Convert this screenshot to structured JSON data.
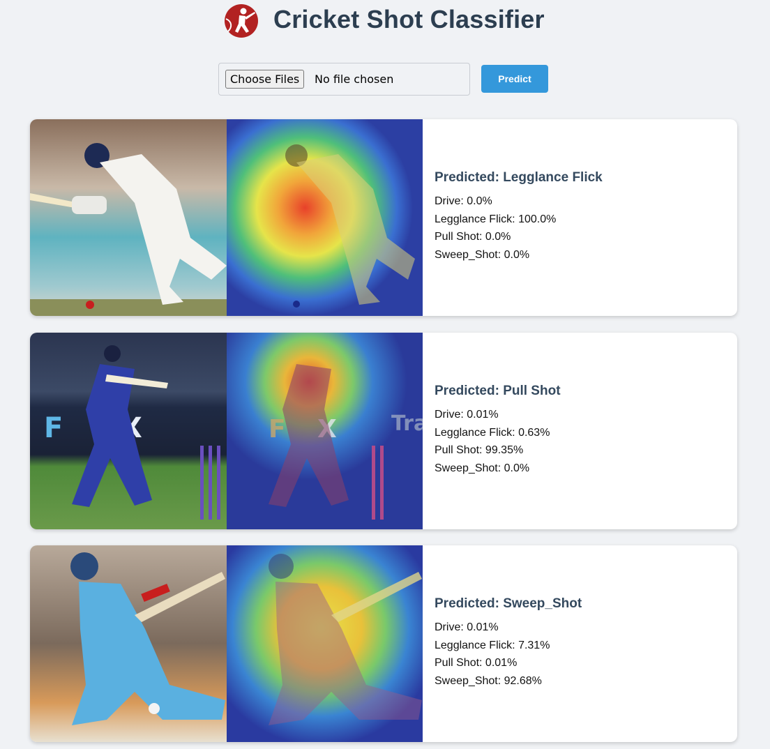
{
  "header": {
    "title": "Cricket Shot Classifier",
    "logo_icon": "cricket-batsman-logo",
    "logo_color": "#b22222"
  },
  "upload": {
    "choose_label": "Choose Files",
    "status_text": "No file chosen",
    "predict_label": "Predict",
    "predict_color": "#3498db"
  },
  "results": [
    {
      "predicted": "Predicted: Legglance Flick",
      "probs": [
        "Drive: 0.0%",
        "Legglance Flick: 100.0%",
        "Pull Shot: 0.0%",
        "Sweep_Shot: 0.0%"
      ]
    },
    {
      "predicted": "Predicted: Pull Shot",
      "probs": [
        "Drive: 0.01%",
        "Legglance Flick: 0.63%",
        "Pull Shot: 99.35%",
        "Sweep_Shot: 0.0%"
      ]
    },
    {
      "predicted": "Predicted: Sweep_Shot",
      "probs": [
        "Drive: 0.01%",
        "Legglance Flick: 7.31%",
        "Pull Shot: 0.01%",
        "Sweep_Shot: 92.68%"
      ]
    }
  ]
}
